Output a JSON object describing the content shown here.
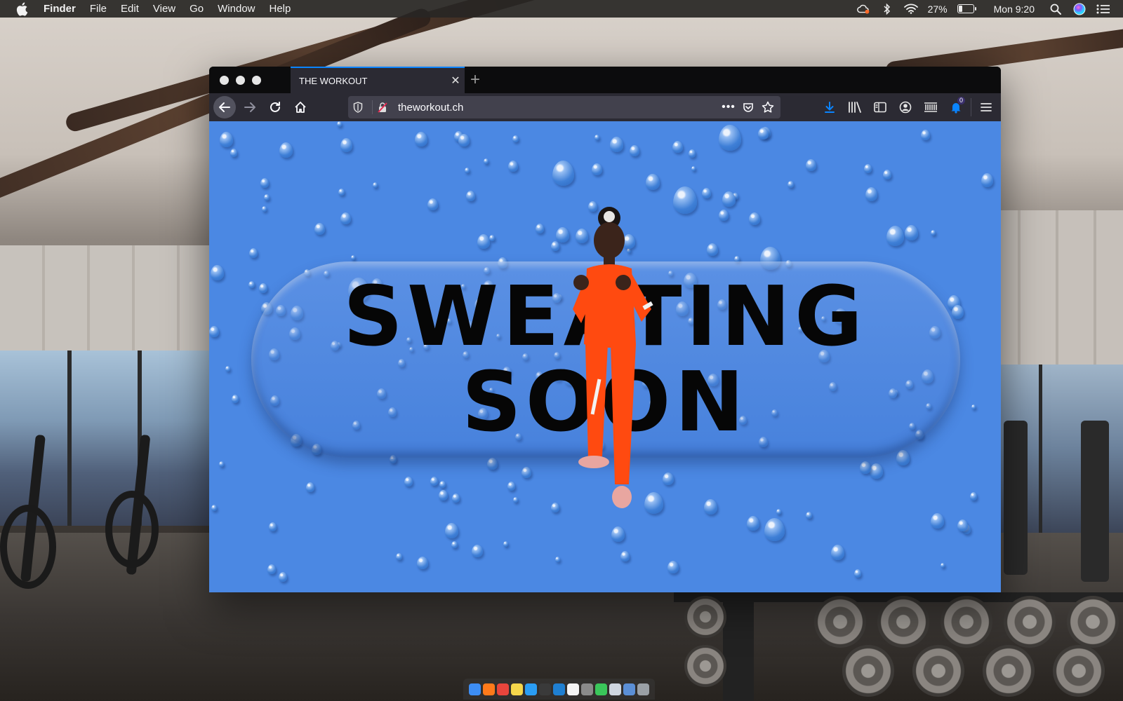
{
  "menubar": {
    "app_name": "Finder",
    "menus": [
      "File",
      "Edit",
      "View",
      "Go",
      "Window",
      "Help"
    ],
    "battery_percent": "27%",
    "battery_level": 0.27,
    "clock": "Mon 9:20",
    "icons": [
      "apple-icon",
      "creative-cloud-icon",
      "bluetooth-icon",
      "wifi-icon",
      "battery-icon",
      "spotlight-icon",
      "siri-icon",
      "notification-center-icon"
    ]
  },
  "browser": {
    "tab_title": "THE WORKOUT",
    "url": "theworkout.ch",
    "downloads_badge": "0",
    "accent": "#0a84ff"
  },
  "page": {
    "headline_line1": "SWEATING",
    "headline_line2": "SOON",
    "background_color": "#4b88e3"
  },
  "dock": {
    "icons": [
      "finder-icon",
      "firefox-icon",
      "chrome-icon",
      "notes-icon",
      "safari-icon",
      "terminal-icon",
      "vscode-icon",
      "calendar-icon",
      "preview-icon",
      "messages-icon",
      "folder-icon",
      "downloads-icon",
      "trash-icon"
    ]
  }
}
